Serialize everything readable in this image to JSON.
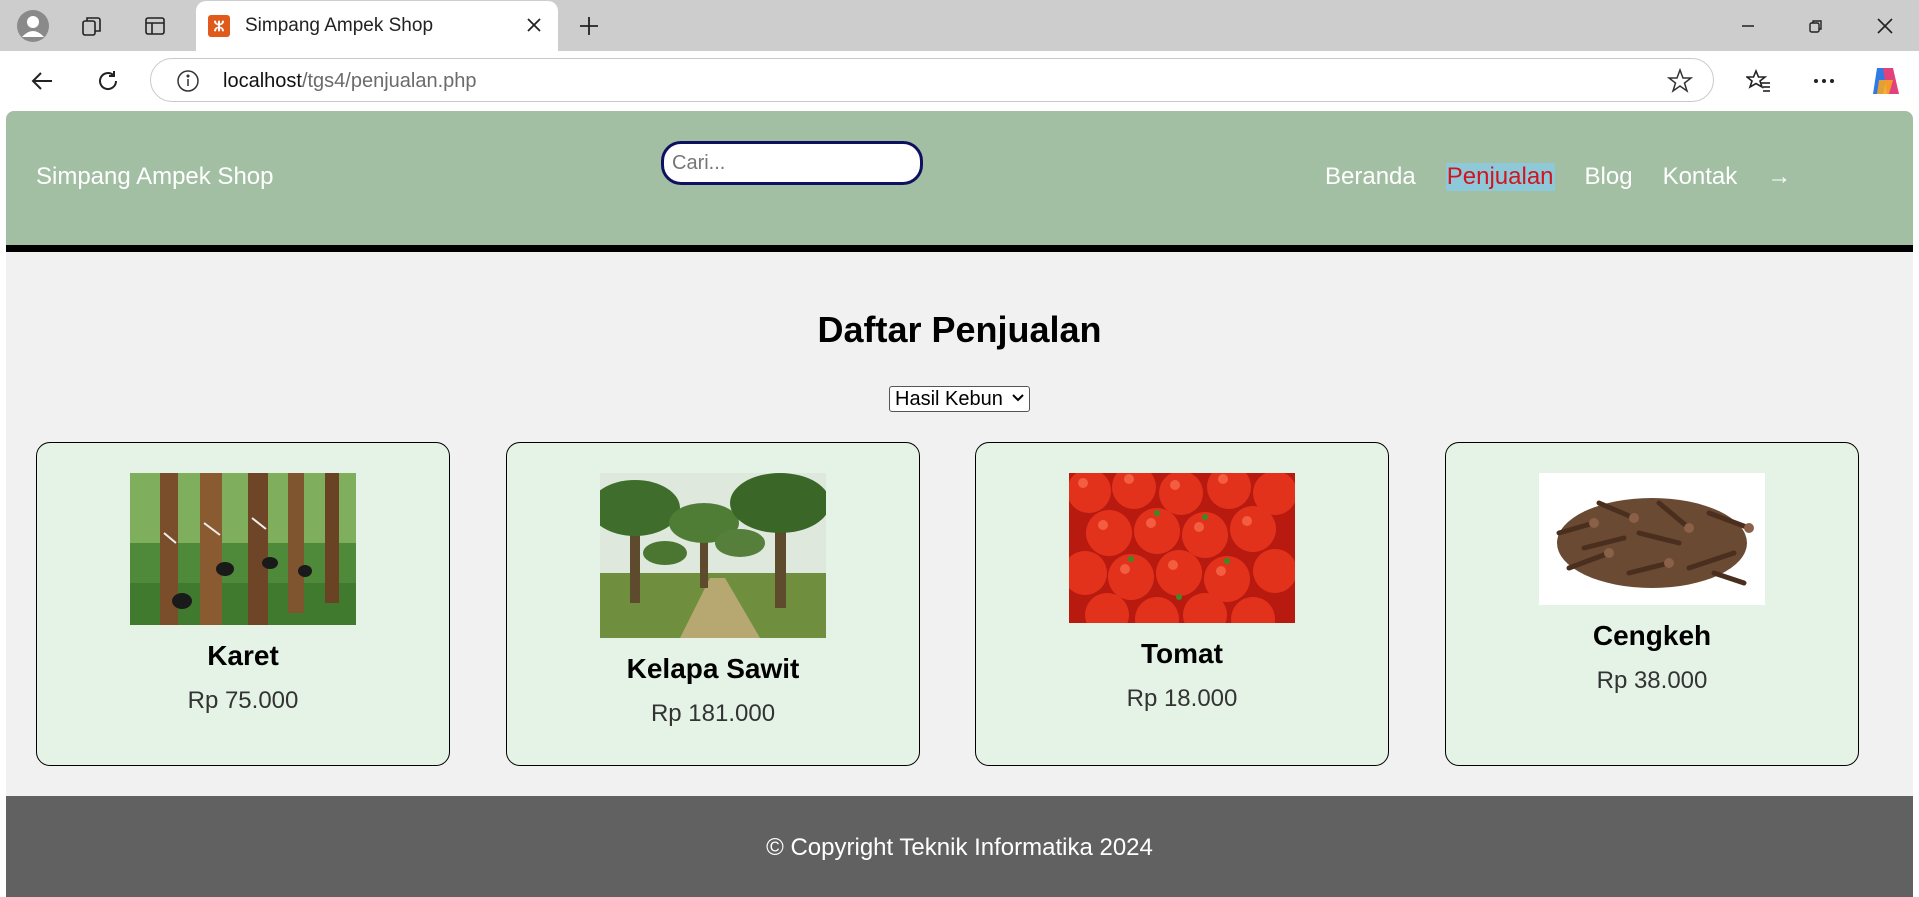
{
  "browser": {
    "tab_title": "Simpang Ampek Shop",
    "url_host": "localhost",
    "url_path": "/tgs4/penjualan.php"
  },
  "header": {
    "brand": "Simpang Ampek Shop",
    "search_placeholder": "Cari...",
    "nav": [
      {
        "label": "Beranda",
        "active": false
      },
      {
        "label": "Penjualan",
        "active": true
      },
      {
        "label": "Blog",
        "active": false
      },
      {
        "label": "Kontak",
        "active": false
      }
    ],
    "logout_arrow": "→"
  },
  "main": {
    "title": "Daftar Penjualan",
    "category_selected": "Hasil Kebun",
    "products": [
      {
        "name": "Karet",
        "price": "Rp 75.000",
        "image": "rubber-tree-image"
      },
      {
        "name": "Kelapa Sawit",
        "price": "Rp 181.000",
        "image": "oil-palm-image"
      },
      {
        "name": "Tomat",
        "price": "Rp 18.000",
        "image": "tomato-image"
      },
      {
        "name": "Cengkeh",
        "price": "Rp 38.000",
        "image": "clove-image"
      }
    ]
  },
  "footer": {
    "text": "© Copyright Teknik Informatika 2024"
  },
  "colors": {
    "header_bg": "#a2bfa3",
    "card_bg": "#e5f3e6",
    "footer_bg": "#616161",
    "active_nav_text": "#d01520",
    "active_nav_bg": "#8ec9d9"
  }
}
